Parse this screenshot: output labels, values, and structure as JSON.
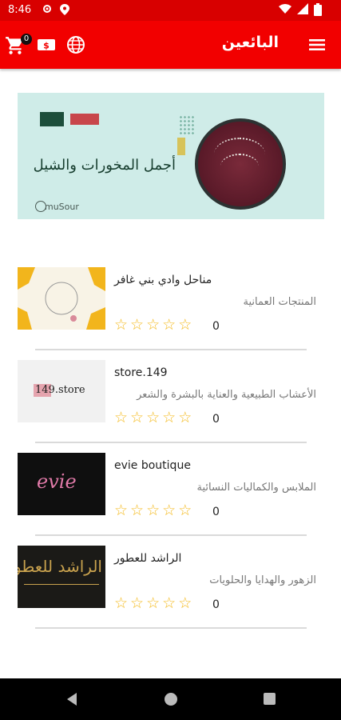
{
  "status_bar": {
    "time": "8:46"
  },
  "app_bar": {
    "title": "البائعين",
    "cart_badge": "0"
  },
  "banner": {
    "headline": "أجمل المخورات والشيل",
    "brand": "muSour"
  },
  "vendors": [
    {
      "name": "مناحل وادي بني غافر",
      "category": "المنتجات العمانية",
      "rating_count": "0",
      "rating": 0,
      "image_caption": ""
    },
    {
      "name": "store.149",
      "category": "الأعشاب الطبيعية والعناية بالبشرة والشعر",
      "rating_count": "0",
      "rating": 0,
      "image_caption": "149.store"
    },
    {
      "name": "evie boutique",
      "category": "الملابس والكماليات النسائية",
      "rating_count": "0",
      "rating": 0,
      "image_caption": "evie"
    },
    {
      "name": "الراشد للعطور",
      "category": "الزهور والهدايا والحلويات",
      "rating_count": "0",
      "rating": 0,
      "image_caption": "الراشد للعطو"
    }
  ],
  "colors": {
    "primary": "#f20000",
    "status": "#d80000",
    "star": "#f4ba1e"
  }
}
